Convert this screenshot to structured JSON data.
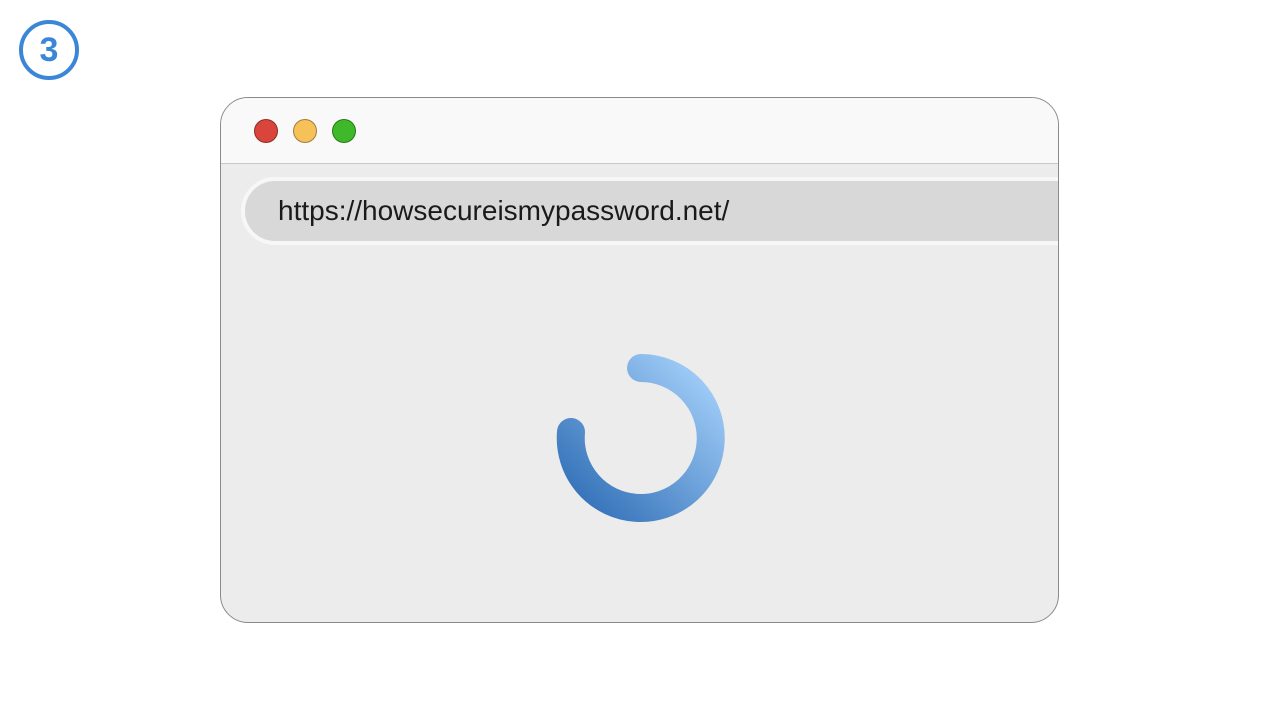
{
  "step": {
    "number": "3",
    "color": "#3b86d6"
  },
  "window": {
    "controls": [
      {
        "name": "close",
        "color": "#d9453b"
      },
      {
        "name": "minimize",
        "color": "#f7c15a"
      },
      {
        "name": "maximize",
        "color": "#3fb929"
      }
    ],
    "address_bar": {
      "url": "https://howsecureismypassword.net/"
    }
  },
  "content": {
    "state": "loading",
    "spinner": {
      "icon": "loading-spinner-icon",
      "color_start": "#2e6db5",
      "color_end": "#a6d1fb"
    }
  }
}
